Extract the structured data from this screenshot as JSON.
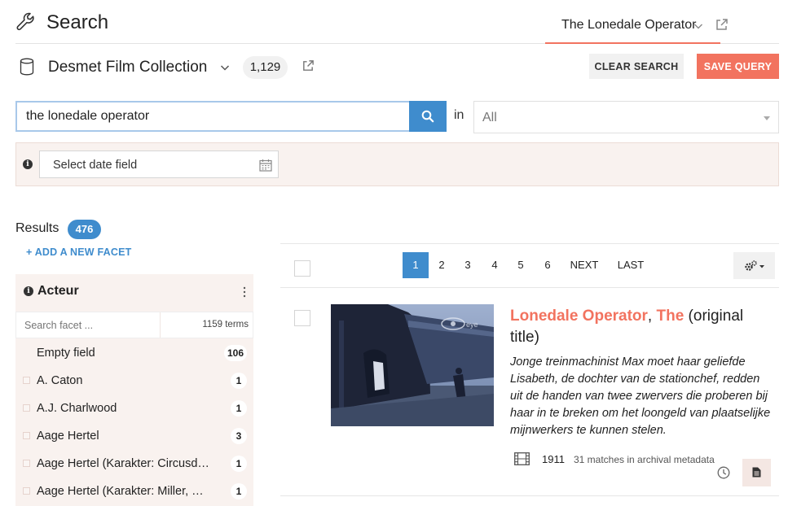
{
  "header": {
    "title": "Search",
    "active_tab": "The Lonedale Operator"
  },
  "collection": {
    "name": "Desmet Film Collection",
    "count": "1,129"
  },
  "actions": {
    "clear_label": "CLEAR SEARCH",
    "save_label": "SAVE QUERY"
  },
  "search": {
    "query": "the lonedale operator",
    "in_label": "in",
    "field_value": "All"
  },
  "date": {
    "placeholder": "Select date field"
  },
  "results": {
    "label": "Results",
    "count": "476",
    "add_facet": "+ ADD A NEW FACET"
  },
  "facet": {
    "title": "Acteur",
    "search_placeholder": "Search facet ...",
    "terms": "1159 terms",
    "items": [
      {
        "label": "Empty field",
        "count": "106"
      },
      {
        "label": "A. Caton",
        "count": "1"
      },
      {
        "label": "A.J. Charlwood",
        "count": "1"
      },
      {
        "label": "Aage Hertel",
        "count": "3"
      },
      {
        "label": "Aage Hertel (Karakter: Circusd…",
        "count": "1"
      },
      {
        "label": "Aage Hertel (Karakter: Miller, …",
        "count": "1"
      }
    ]
  },
  "pagination": {
    "pages": [
      "1",
      "2",
      "3",
      "4",
      "5",
      "6"
    ],
    "active": "1",
    "next": "NEXT",
    "last": "LAST"
  },
  "result": {
    "title_hl1": "Lonedale Operator",
    "title_sep": ", ",
    "title_hl2": "The",
    "title_rest": " (original title)",
    "description": "Jonge treinmachinist Max moet haar geliefde Lisabeth, de dochter van de stationchef, redden uit de handen van twee zwervers die proberen bij haar in te breken om het loongeld van plaatselijke mijnwerkers te kunnen stelen.",
    "year": "1911",
    "matches": "31 matches in archival metadata",
    "watermark": "eye"
  },
  "colors": {
    "accent": "#f2735f",
    "primary": "#3f8ccd",
    "panel": "#f9f2ef"
  }
}
